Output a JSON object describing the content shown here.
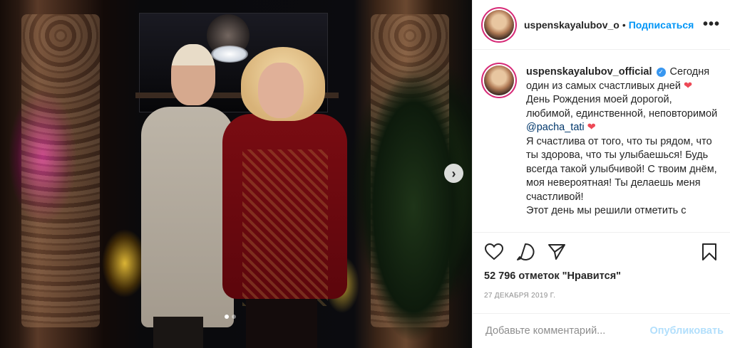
{
  "post": {
    "username": "uspenskayalubov_o",
    "follow_label": "Подписаться",
    "separator": "•",
    "more_label": "•••"
  },
  "caption": {
    "username": "uspenskayalubov_official",
    "verified_mark": "✓",
    "line1": "Сегодня один из самых счастливых дней",
    "line2": "День Рождения моей дорогой, любимой, единственной, неповторимой",
    "mention": "@pacha_tati",
    "line3": "Я счастлива от того, что ты рядом, что ты здорова, что ты улыбаешься! Будь всегда такой улыбчивой! С твоим днём, моя невероятная! Ты делаешь меня счастливой!",
    "line4": "Этот день мы решили отметить с",
    "heart": "❤"
  },
  "stats": {
    "likes": "52 796 отметок \"Нравится\"",
    "date": "27 декабря 2019 г."
  },
  "comment": {
    "placeholder": "Добавьте комментарий...",
    "publish_label": "Опубликовать"
  },
  "carousel": {
    "next_glyph": "›",
    "slides": 2,
    "active_index": 0
  },
  "colors": {
    "link_blue": "#0095f6",
    "heart_red": "#ed4956",
    "mention": "#00376b",
    "muted": "#8e8e8e",
    "publish_disabled": "#b2dffc"
  },
  "icons": [
    "heart-icon",
    "comment-icon",
    "share-icon",
    "bookmark-icon",
    "verified-icon",
    "more-icon",
    "chevron-right-icon"
  ]
}
